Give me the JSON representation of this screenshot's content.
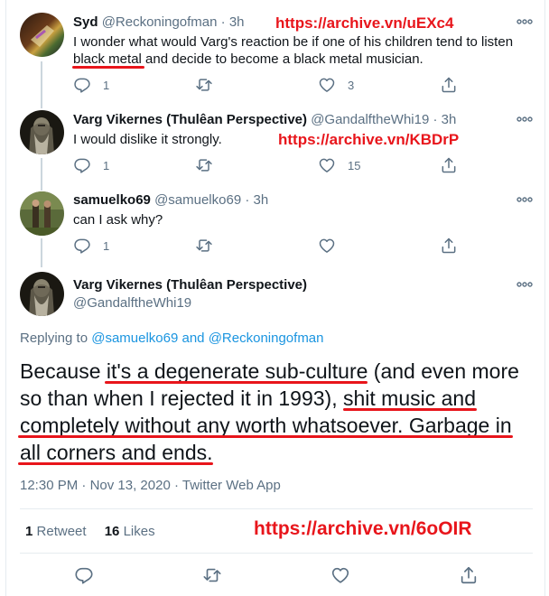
{
  "tweets": [
    {
      "name": "Syd",
      "handle": "@Reckoningofman",
      "time": "3h",
      "text_before": "I wonder what would Varg's reaction be if one of his children tend to listen ",
      "text_highlight": "black metal",
      "text_after": " and decide to become a black metal musician.",
      "replies": "1",
      "retweets": "",
      "likes": "3",
      "annotation_url": "https://archive.vn/uEXc4"
    },
    {
      "name": "Varg Vikernes (Thulêan Perspective)",
      "handle": "@GandalftheWhi19",
      "time": "3h",
      "text": "I would dislike it strongly.",
      "replies": "1",
      "retweets": "",
      "likes": "15",
      "annotation_url": "https://archive.vn/KBDrP"
    },
    {
      "name": "samuelko69",
      "handle": "@samuelko69",
      "time": "3h",
      "text": "can I ask why?",
      "replies": "1",
      "retweets": "",
      "likes": ""
    }
  ],
  "main_tweet": {
    "name": "Varg Vikernes (Thulêan Perspective)",
    "handle": "@GandalftheWhi19",
    "replying_prefix": "Replying to ",
    "replying_user1": "@samuelko69",
    "replying_and": " and ",
    "replying_user2": "@Reckoningofman",
    "text_1": "Because ",
    "text_2": "it's a degenerate sub-culture",
    "text_3": " (and even more so than when I rejected it in 1993), ",
    "text_4": "shit music and completely without any worth whatsoever. Garbage in all corners and ends.",
    "time": "12:30 PM",
    "date": "Nov 13, 2020",
    "source": "Twitter Web App",
    "retweet_count": "1",
    "retweet_label": "Retweet",
    "like_count": "16",
    "like_label": "Likes",
    "annotation_url": "https://archive.vn/6oOIR"
  },
  "colors": {
    "annotation_red": "#e8151b",
    "link_blue": "#1b95e0",
    "muted": "#5b7083"
  }
}
